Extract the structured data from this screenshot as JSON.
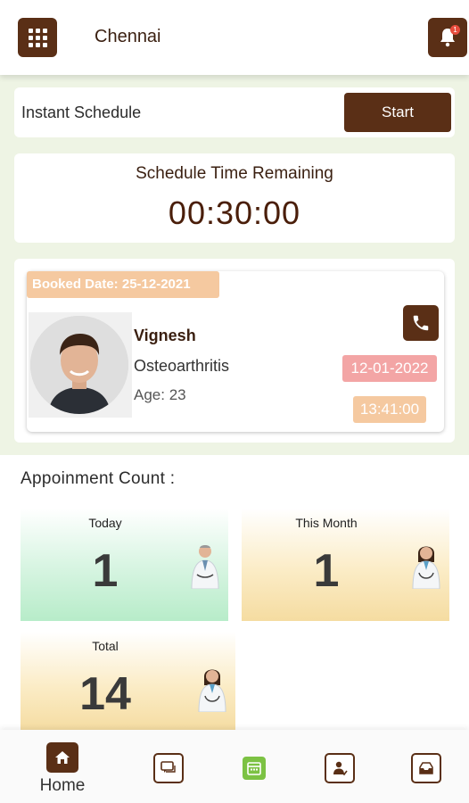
{
  "header": {
    "city": "Chennai",
    "menu_icon": "grid-icon",
    "bell_icon": "bell-icon",
    "notification_count": "1"
  },
  "instant_schedule": {
    "label": "Instant Schedule",
    "button_label": "Start"
  },
  "schedule_timer": {
    "title": "Schedule Time Remaining",
    "value": "00:30:00"
  },
  "appointment": {
    "booked_date": "Booked Date: 25-12-2021",
    "patient_name": "Vignesh",
    "condition": "Osteoarthritis",
    "age": "Age: 23",
    "date": "12-01-2022",
    "time": "13:41:00",
    "call_icon": "phone-icon"
  },
  "counts": {
    "title": "Appoinment Count :",
    "tiles": [
      {
        "label": "Today",
        "value": "1"
      },
      {
        "label": "This Month",
        "value": "1"
      },
      {
        "label": "Total",
        "value": "14"
      }
    ]
  },
  "bottom_nav": {
    "items": [
      {
        "label": "Home",
        "icon": "home-icon"
      },
      {
        "label": "",
        "icon": "chat-icon"
      },
      {
        "label": "",
        "icon": "calendar-icon"
      },
      {
        "label": "",
        "icon": "patient-icon"
      },
      {
        "label": "",
        "icon": "inbox-icon"
      }
    ]
  },
  "colors": {
    "brand": "#5a2f16",
    "region_bg": "#eef4e4",
    "booked_tag": "#f5c9a0",
    "date_tag": "#f3a5a5",
    "active_nav": "#7cc243"
  }
}
